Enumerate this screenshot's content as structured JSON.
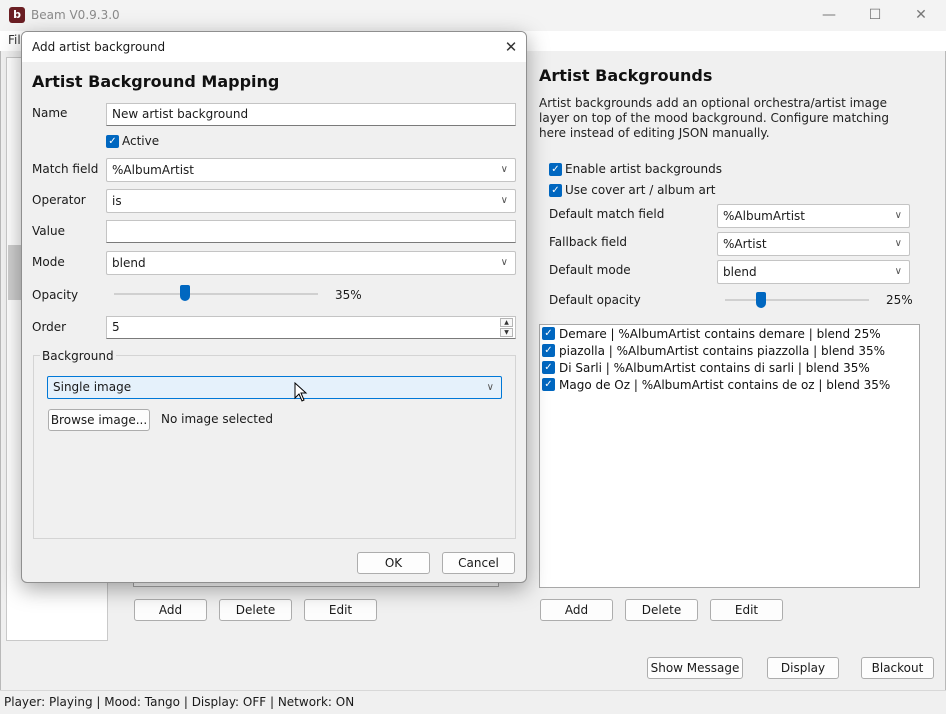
{
  "window": {
    "title": "Beam V0.9.3.0",
    "app_icon": "b",
    "menu_first": "File",
    "menu_visible": "Fil"
  },
  "window_controls": {
    "minimize": "—",
    "maximize": "☐",
    "close": "✕"
  },
  "left_buttons": {
    "add": "Add",
    "delete": "Delete",
    "edit": "Edit"
  },
  "right_panel": {
    "title": "Artist Backgrounds",
    "description": "Artist backgrounds add an optional orchestra/artist image layer on top of the mood background. Configure matching here instead of editing JSON manually.",
    "enable_label": "Enable artist backgrounds",
    "cover_label": "Use cover art / album art",
    "default_match_label": "Default match field",
    "default_match_value": "%AlbumArtist",
    "fallback_label": "Fallback field",
    "fallback_value": "%Artist",
    "default_mode_label": "Default mode",
    "default_mode_value": "blend",
    "default_opacity_label": "Default opacity",
    "default_opacity_value": "25%",
    "default_opacity_fraction": 0.25,
    "list": [
      "Demare | %AlbumArtist contains demare | blend 25%",
      "piazolla | %AlbumArtist contains piazzolla | blend 35%",
      "Di Sarli | %AlbumArtist contains di sarli | blend 35%",
      "Mago de Oz | %AlbumArtist contains de oz | blend 35%"
    ],
    "buttons": {
      "add": "Add",
      "delete": "Delete",
      "edit": "Edit"
    }
  },
  "bottom_buttons": {
    "show_message": "Show Message",
    "display": "Display",
    "blackout": "Blackout"
  },
  "status": "Player: Playing | Mood: Tango | Display: OFF | Network: ON",
  "dialog": {
    "title": "Add artist background",
    "heading": "Artist Background Mapping",
    "name_label": "Name",
    "name_value": "New artist background",
    "active_label": "Active",
    "match_label": "Match field",
    "match_value": "%AlbumArtist",
    "operator_label": "Operator",
    "operator_value": "is",
    "value_label": "Value",
    "value_value": "",
    "mode_label": "Mode",
    "mode_value": "blend",
    "opacity_label": "Opacity",
    "opacity_value": "35%",
    "opacity_fraction": 0.35,
    "order_label": "Order",
    "order_value": "5",
    "background_label": "Background",
    "background_type": "Single image",
    "browse_label": "Browse image...",
    "no_image": "No image selected",
    "ok": "OK",
    "cancel": "Cancel"
  },
  "colors": {
    "accent": "#0067c0",
    "app_icon": "#6b1f24"
  }
}
